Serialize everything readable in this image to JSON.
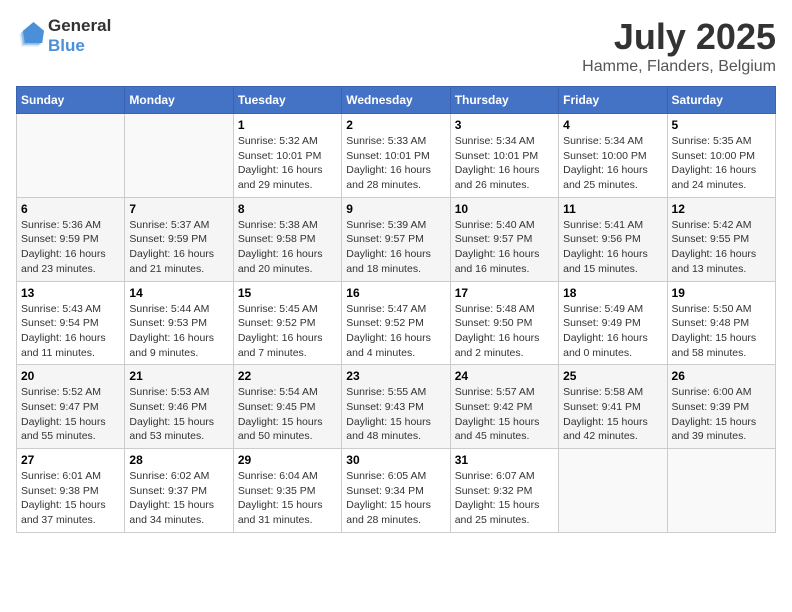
{
  "logo": {
    "line1": "General",
    "line2": "Blue"
  },
  "title": "July 2025",
  "subtitle": "Hamme, Flanders, Belgium",
  "headers": [
    "Sunday",
    "Monday",
    "Tuesday",
    "Wednesday",
    "Thursday",
    "Friday",
    "Saturday"
  ],
  "weeks": [
    [
      {
        "day": "",
        "sunrise": "",
        "sunset": "",
        "daylight": ""
      },
      {
        "day": "",
        "sunrise": "",
        "sunset": "",
        "daylight": ""
      },
      {
        "day": "1",
        "sunrise": "Sunrise: 5:32 AM",
        "sunset": "Sunset: 10:01 PM",
        "daylight": "Daylight: 16 hours and 29 minutes."
      },
      {
        "day": "2",
        "sunrise": "Sunrise: 5:33 AM",
        "sunset": "Sunset: 10:01 PM",
        "daylight": "Daylight: 16 hours and 28 minutes."
      },
      {
        "day": "3",
        "sunrise": "Sunrise: 5:34 AM",
        "sunset": "Sunset: 10:01 PM",
        "daylight": "Daylight: 16 hours and 26 minutes."
      },
      {
        "day": "4",
        "sunrise": "Sunrise: 5:34 AM",
        "sunset": "Sunset: 10:00 PM",
        "daylight": "Daylight: 16 hours and 25 minutes."
      },
      {
        "day": "5",
        "sunrise": "Sunrise: 5:35 AM",
        "sunset": "Sunset: 10:00 PM",
        "daylight": "Daylight: 16 hours and 24 minutes."
      }
    ],
    [
      {
        "day": "6",
        "sunrise": "Sunrise: 5:36 AM",
        "sunset": "Sunset: 9:59 PM",
        "daylight": "Daylight: 16 hours and 23 minutes."
      },
      {
        "day": "7",
        "sunrise": "Sunrise: 5:37 AM",
        "sunset": "Sunset: 9:59 PM",
        "daylight": "Daylight: 16 hours and 21 minutes."
      },
      {
        "day": "8",
        "sunrise": "Sunrise: 5:38 AM",
        "sunset": "Sunset: 9:58 PM",
        "daylight": "Daylight: 16 hours and 20 minutes."
      },
      {
        "day": "9",
        "sunrise": "Sunrise: 5:39 AM",
        "sunset": "Sunset: 9:57 PM",
        "daylight": "Daylight: 16 hours and 18 minutes."
      },
      {
        "day": "10",
        "sunrise": "Sunrise: 5:40 AM",
        "sunset": "Sunset: 9:57 PM",
        "daylight": "Daylight: 16 hours and 16 minutes."
      },
      {
        "day": "11",
        "sunrise": "Sunrise: 5:41 AM",
        "sunset": "Sunset: 9:56 PM",
        "daylight": "Daylight: 16 hours and 15 minutes."
      },
      {
        "day": "12",
        "sunrise": "Sunrise: 5:42 AM",
        "sunset": "Sunset: 9:55 PM",
        "daylight": "Daylight: 16 hours and 13 minutes."
      }
    ],
    [
      {
        "day": "13",
        "sunrise": "Sunrise: 5:43 AM",
        "sunset": "Sunset: 9:54 PM",
        "daylight": "Daylight: 16 hours and 11 minutes."
      },
      {
        "day": "14",
        "sunrise": "Sunrise: 5:44 AM",
        "sunset": "Sunset: 9:53 PM",
        "daylight": "Daylight: 16 hours and 9 minutes."
      },
      {
        "day": "15",
        "sunrise": "Sunrise: 5:45 AM",
        "sunset": "Sunset: 9:52 PM",
        "daylight": "Daylight: 16 hours and 7 minutes."
      },
      {
        "day": "16",
        "sunrise": "Sunrise: 5:47 AM",
        "sunset": "Sunset: 9:52 PM",
        "daylight": "Daylight: 16 hours and 4 minutes."
      },
      {
        "day": "17",
        "sunrise": "Sunrise: 5:48 AM",
        "sunset": "Sunset: 9:50 PM",
        "daylight": "Daylight: 16 hours and 2 minutes."
      },
      {
        "day": "18",
        "sunrise": "Sunrise: 5:49 AM",
        "sunset": "Sunset: 9:49 PM",
        "daylight": "Daylight: 16 hours and 0 minutes."
      },
      {
        "day": "19",
        "sunrise": "Sunrise: 5:50 AM",
        "sunset": "Sunset: 9:48 PM",
        "daylight": "Daylight: 15 hours and 58 minutes."
      }
    ],
    [
      {
        "day": "20",
        "sunrise": "Sunrise: 5:52 AM",
        "sunset": "Sunset: 9:47 PM",
        "daylight": "Daylight: 15 hours and 55 minutes."
      },
      {
        "day": "21",
        "sunrise": "Sunrise: 5:53 AM",
        "sunset": "Sunset: 9:46 PM",
        "daylight": "Daylight: 15 hours and 53 minutes."
      },
      {
        "day": "22",
        "sunrise": "Sunrise: 5:54 AM",
        "sunset": "Sunset: 9:45 PM",
        "daylight": "Daylight: 15 hours and 50 minutes."
      },
      {
        "day": "23",
        "sunrise": "Sunrise: 5:55 AM",
        "sunset": "Sunset: 9:43 PM",
        "daylight": "Daylight: 15 hours and 48 minutes."
      },
      {
        "day": "24",
        "sunrise": "Sunrise: 5:57 AM",
        "sunset": "Sunset: 9:42 PM",
        "daylight": "Daylight: 15 hours and 45 minutes."
      },
      {
        "day": "25",
        "sunrise": "Sunrise: 5:58 AM",
        "sunset": "Sunset: 9:41 PM",
        "daylight": "Daylight: 15 hours and 42 minutes."
      },
      {
        "day": "26",
        "sunrise": "Sunrise: 6:00 AM",
        "sunset": "Sunset: 9:39 PM",
        "daylight": "Daylight: 15 hours and 39 minutes."
      }
    ],
    [
      {
        "day": "27",
        "sunrise": "Sunrise: 6:01 AM",
        "sunset": "Sunset: 9:38 PM",
        "daylight": "Daylight: 15 hours and 37 minutes."
      },
      {
        "day": "28",
        "sunrise": "Sunrise: 6:02 AM",
        "sunset": "Sunset: 9:37 PM",
        "daylight": "Daylight: 15 hours and 34 minutes."
      },
      {
        "day": "29",
        "sunrise": "Sunrise: 6:04 AM",
        "sunset": "Sunset: 9:35 PM",
        "daylight": "Daylight: 15 hours and 31 minutes."
      },
      {
        "day": "30",
        "sunrise": "Sunrise: 6:05 AM",
        "sunset": "Sunset: 9:34 PM",
        "daylight": "Daylight: 15 hours and 28 minutes."
      },
      {
        "day": "31",
        "sunrise": "Sunrise: 6:07 AM",
        "sunset": "Sunset: 9:32 PM",
        "daylight": "Daylight: 15 hours and 25 minutes."
      },
      {
        "day": "",
        "sunrise": "",
        "sunset": "",
        "daylight": ""
      },
      {
        "day": "",
        "sunrise": "",
        "sunset": "",
        "daylight": ""
      }
    ]
  ]
}
